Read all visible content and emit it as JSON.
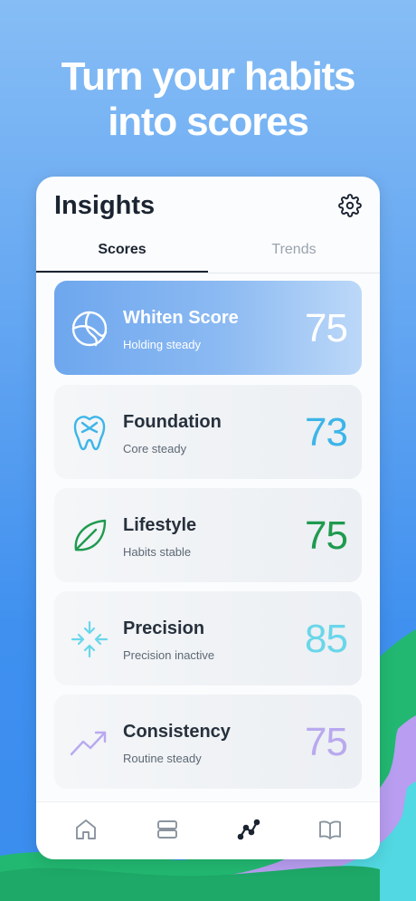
{
  "headline": {
    "line1": "Turn your habits",
    "line2": "into scores"
  },
  "screen": {
    "title": "Insights",
    "settings_icon": "gear-icon",
    "tabs": [
      {
        "label": "Scores",
        "active": true
      },
      {
        "label": "Trends",
        "active": false
      }
    ],
    "scores": [
      {
        "name": "Whiten Score",
        "status": "Holding steady",
        "value": "75",
        "icon": "globe-icon",
        "color": "#ffffff",
        "highlighted": true
      },
      {
        "name": "Foundation",
        "status": "Core steady",
        "value": "73",
        "icon": "tooth-icon",
        "color": "#3db5e8",
        "highlighted": false
      },
      {
        "name": "Lifestyle",
        "status": "Habits stable",
        "value": "75",
        "icon": "leaf-icon",
        "color": "#1f9a4f",
        "highlighted": false
      },
      {
        "name": "Precision",
        "status": "Precision inactive",
        "value": "85",
        "icon": "arrows-inward-icon",
        "color": "#6ad6ea",
        "highlighted": false
      },
      {
        "name": "Consistency",
        "status": "Routine steady",
        "value": "75",
        "icon": "trend-up-icon",
        "color": "#b9a9ef",
        "highlighted": false
      }
    ],
    "nav": [
      {
        "icon": "home-icon",
        "active": false
      },
      {
        "icon": "list-icon",
        "active": false
      },
      {
        "icon": "insights-icon",
        "active": true
      },
      {
        "icon": "book-icon",
        "active": false
      }
    ]
  }
}
